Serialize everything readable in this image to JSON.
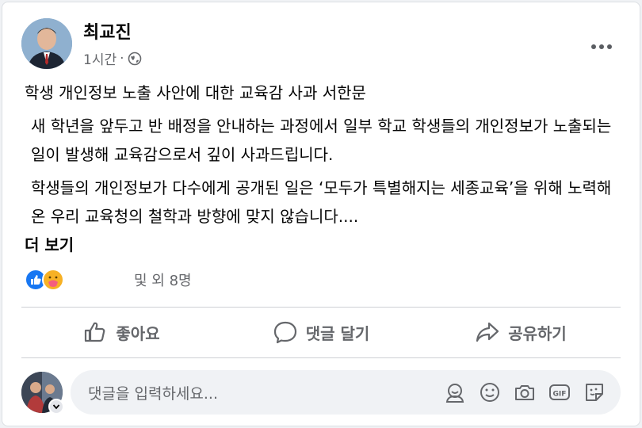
{
  "post": {
    "author": "최교진",
    "time": "1시간",
    "separator": "·",
    "title": "학생 개인정보 노출 사안에 대한 교육감 사과 서한문",
    "para1": "새 학년을 앞두고 반 배정을 안내하는 과정에서 일부 학교 학생들의 개인정보가 노출되는 일이 발생해 교육감으로서 깊이 사과드립니다.",
    "para2": "학생들의 개인정보가 다수에게 공개된 일은 ‘모두가 특별해지는 세종교육’을 위해 노력해 온 우리 교육청의 철학과 방향에 맞지 않습니다....",
    "see_more": "더 보기"
  },
  "reactions": {
    "text": "및 외 8명"
  },
  "actions": {
    "like": "좋아요",
    "comment": "댓글 달기",
    "share": "공유하기"
  },
  "comment_box": {
    "placeholder": "댓글을 입력하세요..."
  },
  "colors": {
    "accent": "#1877f2",
    "care": "#f7b125",
    "muted": "#65676b"
  }
}
